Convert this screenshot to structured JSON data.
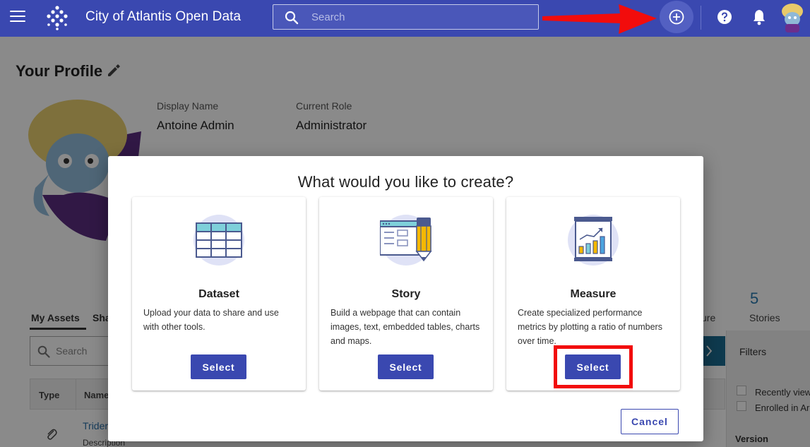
{
  "header": {
    "app_title": "City of Atlantis Open Data",
    "search_placeholder": "Search"
  },
  "profile": {
    "title": "Your Profile",
    "display_name_label": "Display Name",
    "display_name": "Antoine Admin",
    "role_label": "Current Role",
    "role": "Administrator"
  },
  "assets": {
    "tabs": [
      "My Assets",
      "Sha"
    ],
    "search_placeholder": "Search",
    "stat_measure_fragment": "sure",
    "stories_count": "5",
    "stories_label": "Stories",
    "columns": [
      "Type",
      "Name"
    ],
    "col_fragment": "e",
    "rows": [
      {
        "name": "Trider",
        "description": "Description",
        "fragment": "c"
      }
    ]
  },
  "filters": {
    "title": "Filters",
    "options": [
      "Recently view",
      "Enrolled in Arc"
    ],
    "version_label": "Version"
  },
  "modal": {
    "title": "What would you like to create?",
    "cards": [
      {
        "title": "Dataset",
        "description": "Upload your data to share and use with other tools.",
        "button": "Select",
        "icon": "table-icon"
      },
      {
        "title": "Story",
        "description": "Build a webpage that can contain images, text, embedded tables, charts and maps.",
        "button": "Select",
        "icon": "webpage-pencil-icon"
      },
      {
        "title": "Measure",
        "description": "Create specialized performance metrics by plotting a ratio of numbers over time.",
        "button": "Select",
        "icon": "bar-chart-icon"
      }
    ],
    "cancel": "Cancel"
  },
  "colors": {
    "primary": "#3a48b0",
    "card_icon_bg": "#dfe2f6",
    "annotation_red": "#f20c0c",
    "link_blue": "#2a6fa8",
    "teal": "#1b6c90"
  }
}
